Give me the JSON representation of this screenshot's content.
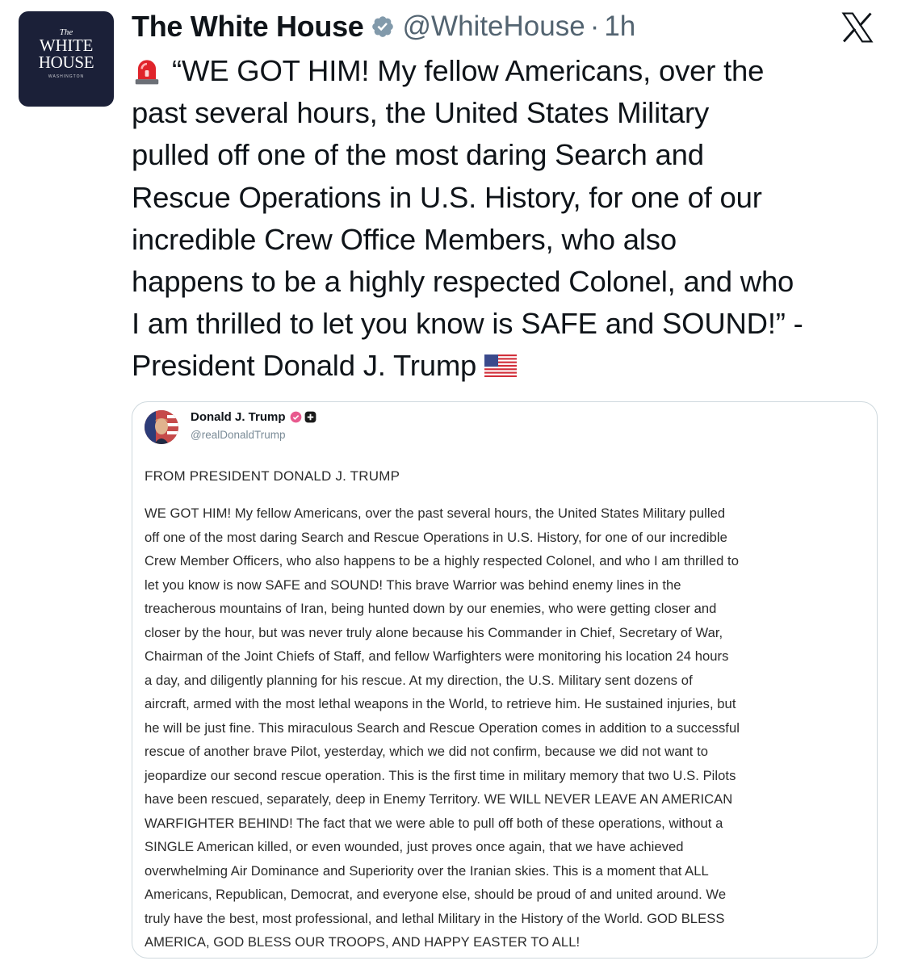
{
  "account": {
    "avatar_top": "The",
    "avatar_line1": "WHITE",
    "avatar_line2": "HOUSE",
    "avatar_sub": "WASHINGTON",
    "name": "The White House",
    "handle": "@WhiteHouse",
    "separator": "·",
    "time": "1h"
  },
  "tweet": {
    "siren_icon": "police-light-emoji",
    "lines": [
      "“WE GOT HIM! My fellow Americans, over the",
      "past several hours, the United States Military",
      "pulled off one of the most daring Search and",
      "Rescue Operations in U.S. History, for one of our",
      "incredible Crew Office Members, who also",
      "happens to be a highly respected Colonel, and who",
      "I am thrilled to let you know is SAFE and SOUND!” -",
      "President Donald J. Trump"
    ],
    "flag_icon": "us-flag-emoji"
  },
  "quoted": {
    "name": "Donald J. Trump",
    "handle": "@realDonaldTrump",
    "heading": "FROM PRESIDENT DONALD J. TRUMP",
    "body_lines": [
      "WE GOT HIM! My fellow Americans, over the past several hours, the United States Military pulled",
      "off one of the most daring Search and Rescue Operations in U.S. History, for one of our incredible",
      "Crew Member Officers, who also happens to be a highly respected Colonel, and who I am thrilled to",
      "let you know is now SAFE and SOUND! This brave Warrior was behind enemy lines in the",
      "treacherous mountains of Iran, being hunted down by our enemies, who were getting closer and",
      "closer by the hour, but was never truly alone because his Commander in Chief, Secretary of War,",
      "Chairman of the Joint Chiefs of Staff, and fellow Warfighters were monitoring his location 24 hours",
      "a day, and diligently planning for his rescue. At my direction, the U.S. Military sent dozens of",
      "aircraft, armed with the most lethal weapons in the World, to retrieve him. He sustained injuries, but",
      "he will be just fine. This miraculous Search and Rescue Operation comes in addition to a successful",
      "rescue of another brave Pilot, yesterday, which we did not confirm, because we did not want to",
      "jeopardize our second rescue operation. This is the first time in military memory that two U.S. Pilots",
      "have been rescued, separately, deep in Enemy Territory. WE WILL NEVER LEAVE AN AMERICAN",
      "WARFIGHTER BEHIND! The fact that we were able to pull off both of these operations, without a",
      "SINGLE American killed, or even wounded, just proves once again, that we have achieved",
      "overwhelming Air Dominance and Superiority over the Iranian skies. This is a moment that ALL",
      "Americans, Republican, Democrat, and everyone else, should be proud of and united around. We",
      "truly have the best, most professional, and lethal Military in the History of the World. GOD BLESS",
      "AMERICA, GOD BLESS OUR TROOPS, AND HAPPY EASTER TO ALL!"
    ]
  },
  "icons": {
    "verified": "verified-badge-icon",
    "x_logo": "x-logo-icon"
  },
  "colors": {
    "text": "#0f1419",
    "secondary": "#536471",
    "verified_badge": "#829aab",
    "avatar_bg": "#1b2038",
    "card_border": "#cfd9de"
  }
}
